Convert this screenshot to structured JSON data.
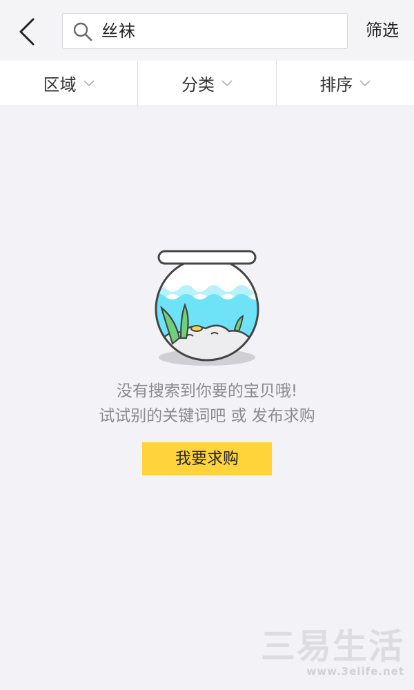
{
  "search": {
    "query": "丝袜"
  },
  "header": {
    "filter_label": "筛选"
  },
  "tabs": [
    {
      "label": "区域"
    },
    {
      "label": "分类"
    },
    {
      "label": "排序"
    }
  ],
  "empty_state": {
    "line1": "没有搜索到你要的宝贝哦!",
    "line2": "试试别的关键词吧 或 发布求购",
    "button_label": "我要求购"
  },
  "watermark": {
    "title": "三易生活",
    "url": "www.3elife.net"
  },
  "colors": {
    "accent": "#ffd43b",
    "water": "#6ee3f7",
    "background": "#f2f2f7"
  }
}
